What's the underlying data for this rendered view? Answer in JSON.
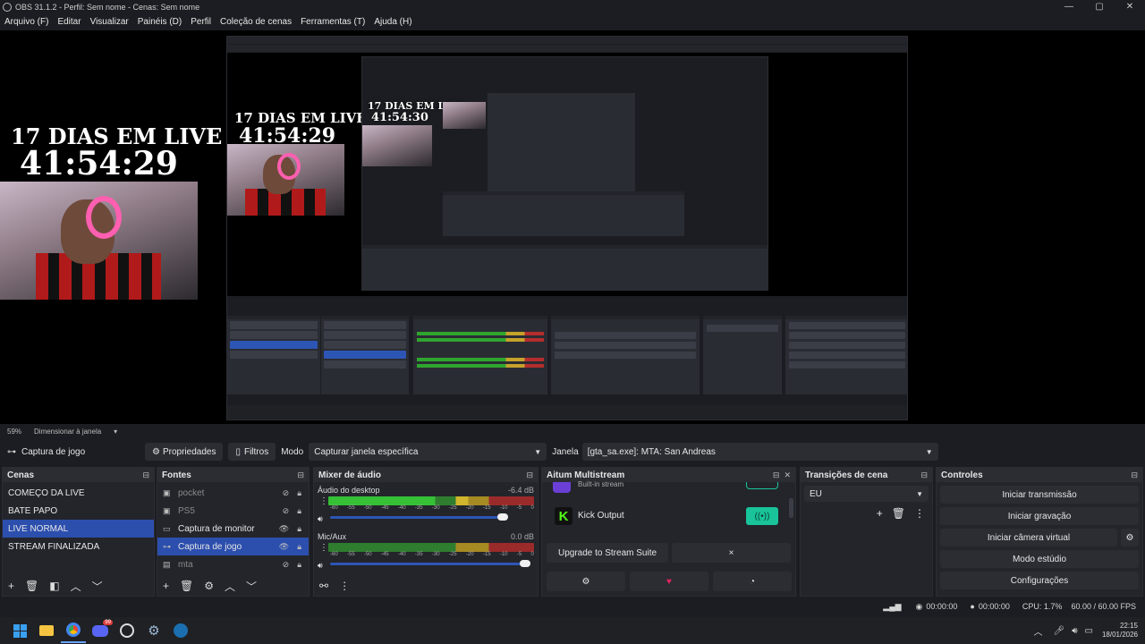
{
  "window": {
    "title": "OBS 31.1.2 - Perfil: Sem nome - Cenas: Sem nome",
    "controls": [
      "—",
      "▢",
      "✕"
    ]
  },
  "menu": [
    "Arquivo (F)",
    "Editar",
    "Visualizar",
    "Painéis (D)",
    "Perfil",
    "Coleção de cenas",
    "Ferramentas (T)",
    "Ajuda (H)"
  ],
  "preview": {
    "overlay_line1": "17 DIAS EM LIVE",
    "overlay_line2": "41:54:29",
    "nested_overlay_line1": "17 DIAS EM LIVE",
    "nested_overlay_line2": "41:54:29",
    "nested2_overlay_line1": "17 DIAS EM LIVE",
    "nested2_overlay_line2": "41:54:30"
  },
  "zoombar": {
    "zoom": "59%",
    "mode": "Dimensionar à janela"
  },
  "source_toolbar": {
    "source_name": "Captura de jogo",
    "properties": "Propriedades",
    "filters": "Filtros",
    "mode_label": "Modo",
    "mode_value": "Capturar janela específica",
    "window_label": "Janela",
    "window_value": "[gta_sa.exe]: MTA: San Andreas"
  },
  "scenes": {
    "title": "Cenas",
    "items": [
      "COMEÇO DA LIVE",
      "BATE PAPO",
      "LIVE NORMAL",
      "STREAM FINALIZADA"
    ],
    "selected_index": 2
  },
  "sources": {
    "title": "Fontes",
    "items": [
      {
        "name": "pocket",
        "icon": "display-icon",
        "visible": false
      },
      {
        "name": "PS5",
        "icon": "display-icon",
        "visible": false
      },
      {
        "name": "Captura de monitor",
        "icon": "monitor-icon",
        "visible": true
      },
      {
        "name": "Captura de jogo",
        "icon": "gamepad-icon",
        "visible": true
      },
      {
        "name": "mta",
        "icon": "window-icon",
        "visible": false
      }
    ],
    "selected_index": 3
  },
  "mixer": {
    "title": "Mixer de áudio",
    "channels": [
      {
        "name": "Áudio do desktop",
        "db": "-6.4 dB",
        "volume": 0.88
      },
      {
        "name": "Mic/Aux",
        "db": "0.0 dB",
        "volume": 1.0
      }
    ],
    "scale": [
      "-60",
      "-55",
      "-50",
      "-45",
      "-40",
      "-35",
      "-30",
      "-25",
      "-20",
      "-15",
      "-10",
      "-5",
      "0"
    ]
  },
  "multistream": {
    "title": "Aitum Multistream",
    "builtin_label": "Built-in stream",
    "kick_label": "Kick Output",
    "upgrade_label": "Upgrade to Stream Suite",
    "close_label": "×"
  },
  "transitions": {
    "title": "Transições de cena",
    "selected": "EU"
  },
  "controls": {
    "title": "Controles",
    "buttons": [
      "Iniciar transmissão",
      "Iniciar gravação",
      "Iniciar câmera virtual",
      "Modo estúdio",
      "Configurações"
    ]
  },
  "status": {
    "stream_time": "00:00:00",
    "rec_time": "00:00:00",
    "cpu": "CPU: 1.7%",
    "fps": "60.00 / 60.00 FPS"
  },
  "taskbar": {
    "discord_badge": "99",
    "time": "22:15",
    "date": "18/01/2026"
  },
  "colors": {
    "selected": "#2c4fae",
    "kick_green": "#53fc18",
    "accent_teal": "#19c49a"
  }
}
